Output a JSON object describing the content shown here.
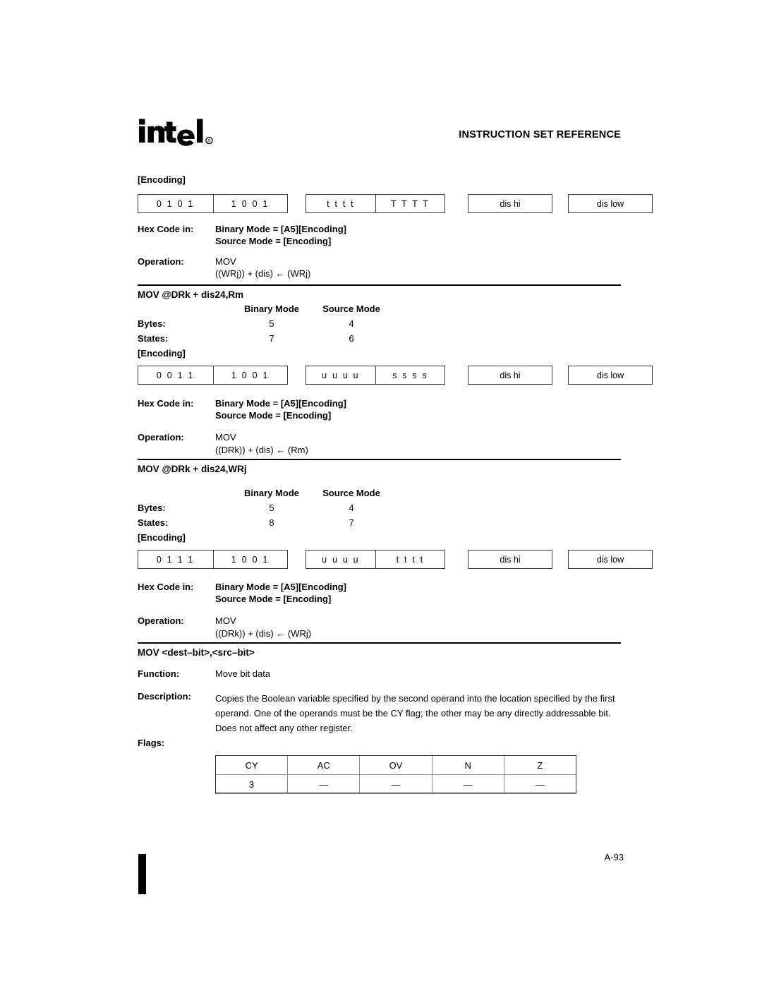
{
  "header": {
    "logo_text": "intel",
    "logo_mark": "®",
    "title": "INSTRUCTION SET REFERENCE"
  },
  "labels": {
    "encoding": "[Encoding]",
    "hex_code_in": "Hex Code in:",
    "operation": "Operation:",
    "bytes": "Bytes:",
    "states": "States:",
    "binary_mode": "Binary Mode",
    "source_mode": "Source Mode",
    "function": "Function:",
    "description": "Description:",
    "flags": "Flags:"
  },
  "hex_code": {
    "binary": "Binary Mode = [A5][Encoding]",
    "source": "Source Mode = [Encoding]"
  },
  "sections": [
    {
      "encoding_cells": [
        "0 1 0 1",
        "1 0 0 1",
        "t t t t",
        "T T T T",
        "dis hi",
        "dis low"
      ],
      "operation_name": "MOV",
      "operation_expr": "((WRj)) + (dis) ← (WRj)"
    },
    {
      "heading": "MOV @DRk + dis24,Rm",
      "bytes": {
        "binary": "5",
        "source": "4"
      },
      "states": {
        "binary": "7",
        "source": "6"
      },
      "encoding_cells": [
        "0 0 1 1",
        "1 0 0 1",
        "u u u u",
        "s s s s",
        "dis hi",
        "dis low"
      ],
      "operation_name": "MOV",
      "operation_expr": "((DRk)) + (dis) ← (Rm)"
    },
    {
      "heading": "MOV @DRk + dis24,WRj",
      "bytes": {
        "binary": "5",
        "source": "4"
      },
      "states": {
        "binary": "8",
        "source": "7"
      },
      "encoding_cells": [
        "0 1 1 1",
        "1 0 0 1",
        "u u u u",
        "t t t t",
        "dis hi",
        "dis low"
      ],
      "operation_name": "MOV",
      "operation_expr": "((DRk)) + (dis) ← (WRj)"
    }
  ],
  "bit_instruction": {
    "heading": "MOV <dest–bit>,<src–bit>",
    "function": "Move bit data",
    "description": "Copies the Boolean variable specified by the second operand into the location specified by the first operand. One of the operands must be the CY flag; the other may be any directly addressable bit. Does not affect any other register."
  },
  "flags_table": {
    "headers": [
      "CY",
      "AC",
      "OV",
      "N",
      "Z"
    ],
    "values": [
      "3",
      "—",
      "—",
      "—",
      "—"
    ]
  },
  "footer": {
    "page_number": "A-93"
  }
}
